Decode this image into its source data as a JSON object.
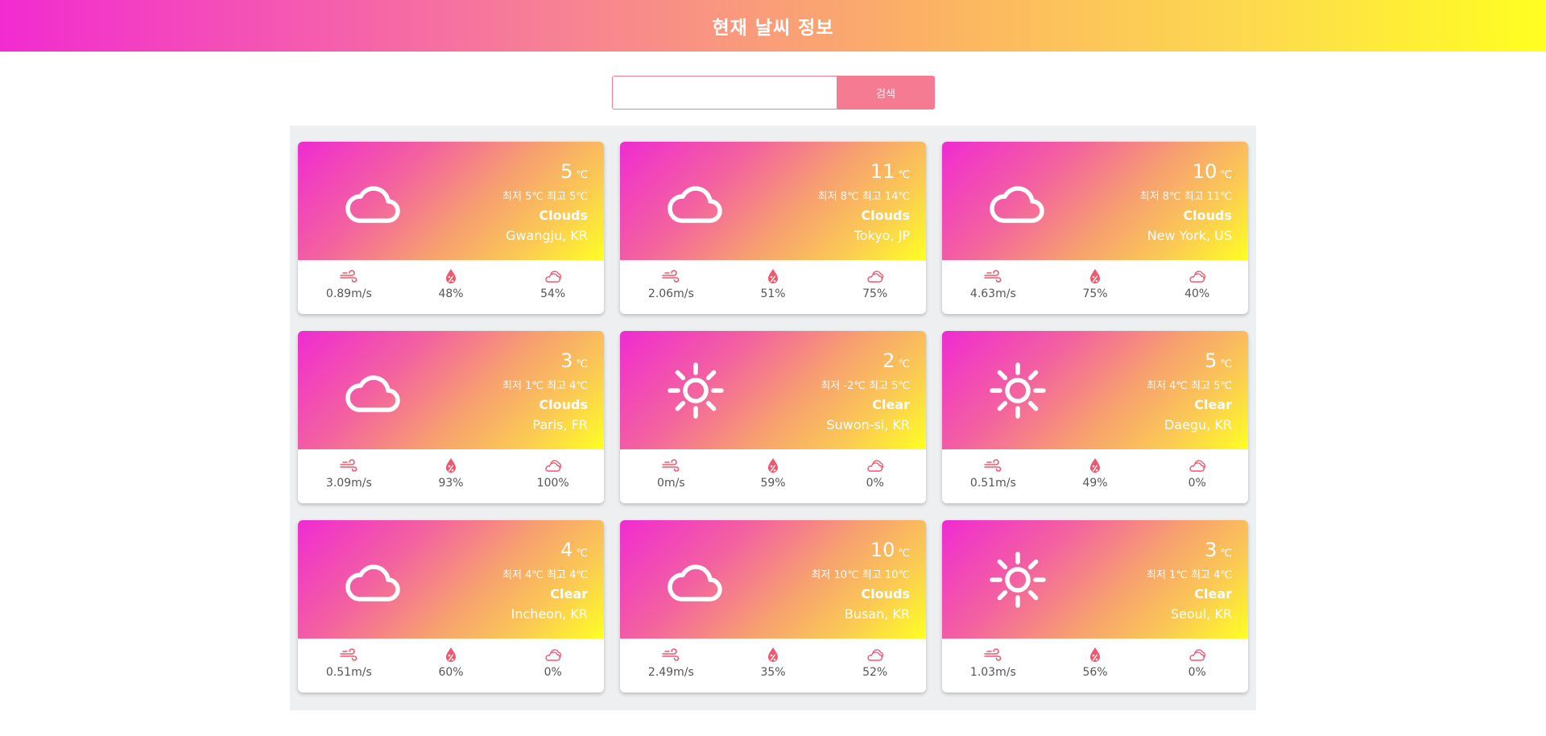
{
  "header": {
    "title": "현재 날씨 정보"
  },
  "search": {
    "placeholder": "",
    "value": "",
    "button_label": "검색"
  },
  "colors": {
    "accent": "#f47b92",
    "gradient_start": "#f22bd0",
    "gradient_end": "#ffff20",
    "panel_bg": "#edeff0"
  },
  "cards": [
    {
      "icon": "cloud-icon",
      "temp": "5",
      "unit": "℃",
      "minmax": "최저 5℃ 최고 5℃",
      "condition": "Clouds",
      "city": "Gwangju, KR",
      "wind": "0.89m/s",
      "humidity": "48%",
      "clouds": "54%"
    },
    {
      "icon": "cloud-icon",
      "temp": "11",
      "unit": "℃",
      "minmax": "최저 8℃ 최고 14℃",
      "condition": "Clouds",
      "city": "Tokyo, JP",
      "wind": "2.06m/s",
      "humidity": "51%",
      "clouds": "75%"
    },
    {
      "icon": "cloud-icon",
      "temp": "10",
      "unit": "℃",
      "minmax": "최저 8℃ 최고 11℃",
      "condition": "Clouds",
      "city": "New York, US",
      "wind": "4.63m/s",
      "humidity": "75%",
      "clouds": "40%"
    },
    {
      "icon": "cloud-icon",
      "temp": "3",
      "unit": "℃",
      "minmax": "최저 1℃ 최고 4℃",
      "condition": "Clouds",
      "city": "Paris, FR",
      "wind": "3.09m/s",
      "humidity": "93%",
      "clouds": "100%"
    },
    {
      "icon": "sun-icon",
      "temp": "2",
      "unit": "℃",
      "minmax": "최저 -2℃ 최고 5℃",
      "condition": "Clear",
      "city": "Suwon-si, KR",
      "wind": "0m/s",
      "humidity": "59%",
      "clouds": "0%"
    },
    {
      "icon": "sun-icon",
      "temp": "5",
      "unit": "℃",
      "minmax": "최저 4℃ 최고 5℃",
      "condition": "Clear",
      "city": "Daegu, KR",
      "wind": "0.51m/s",
      "humidity": "49%",
      "clouds": "0%"
    },
    {
      "icon": "cloud-icon",
      "temp": "4",
      "unit": "℃",
      "minmax": "최저 4℃ 최고 4℃",
      "condition": "Clear",
      "city": "Incheon, KR",
      "wind": "0.51m/s",
      "humidity": "60%",
      "clouds": "0%"
    },
    {
      "icon": "cloud-icon",
      "temp": "10",
      "unit": "℃",
      "minmax": "최저 10℃ 최고 10℃",
      "condition": "Clouds",
      "city": "Busan, KR",
      "wind": "2.49m/s",
      "humidity": "35%",
      "clouds": "52%"
    },
    {
      "icon": "sun-icon",
      "temp": "3",
      "unit": "℃",
      "minmax": "최저 1℃ 최고 4℃",
      "condition": "Clear",
      "city": "Seoul, KR",
      "wind": "1.03m/s",
      "humidity": "56%",
      "clouds": "0%"
    }
  ]
}
